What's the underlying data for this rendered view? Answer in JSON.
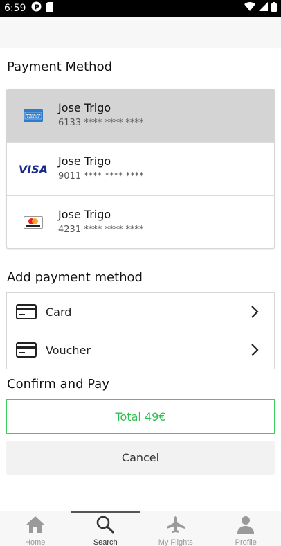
{
  "status_bar": {
    "time": "6:59",
    "icons": [
      "p-icon",
      "sd-card-icon",
      "wifi-icon",
      "signal-icon",
      "battery-icon"
    ]
  },
  "payment_method": {
    "title": "Payment Method",
    "cards": [
      {
        "brand": "amex-icon",
        "holder": "Jose Trigo",
        "number": "6133 **** **** ****",
        "selected": true
      },
      {
        "brand": "visa-icon",
        "holder": "Jose Trigo",
        "number": "9011 **** **** ****",
        "selected": false
      },
      {
        "brand": "mastercard-icon",
        "holder": "Jose Trigo",
        "number": "4231 **** **** ****",
        "selected": false
      }
    ]
  },
  "add_payment": {
    "title": "Add payment method",
    "options": [
      {
        "label": "Card",
        "icon": "credit-card-icon"
      },
      {
        "label": "Voucher",
        "icon": "credit-card-icon"
      }
    ]
  },
  "confirm": {
    "title": "Confirm and Pay",
    "total_label": "Total 49€",
    "cancel_label": "Cancel",
    "accent_color": "#2fbf50"
  },
  "bottom_nav": {
    "items": [
      {
        "label": "Home",
        "icon": "home-icon",
        "active": false
      },
      {
        "label": "Search",
        "icon": "search-icon",
        "active": true
      },
      {
        "label": "My Flights",
        "icon": "airplane-icon",
        "active": false
      },
      {
        "label": "Profile",
        "icon": "person-icon",
        "active": false
      }
    ]
  }
}
